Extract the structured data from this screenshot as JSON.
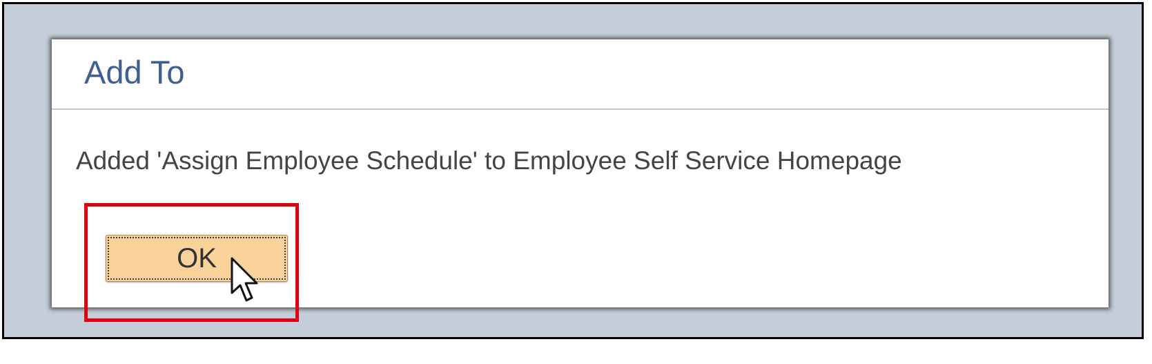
{
  "dialog": {
    "title": "Add To",
    "message": "Added 'Assign Employee Schedule' to Employee Self Service Homepage",
    "ok_label": "OK"
  },
  "annotation": {
    "highlight_color": "#e0000f",
    "highlights": "ok-button"
  },
  "colors": {
    "backdrop": "#c5ced8",
    "title": "#3e5f8f",
    "button_fill": "#fad39b"
  },
  "icons": {
    "cursor": "arrow-pointer-icon"
  }
}
